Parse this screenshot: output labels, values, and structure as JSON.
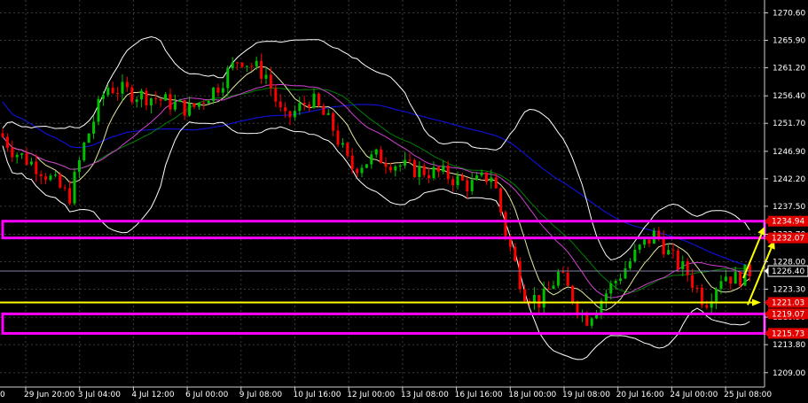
{
  "chart_data": {
    "type": "candlestick",
    "title": "",
    "grid": true,
    "y_axis_side": "right",
    "ylim": [
      1207.3,
      1272.2
    ],
    "y_ticks": [
      "1270.60",
      "1265.90",
      "1261.20",
      "1256.40",
      "1251.70",
      "1246.90",
      "1242.20",
      "1237.50",
      "1232.70",
      "1228.00",
      "1223.30",
      "1218.50",
      "1213.80",
      "1209.00"
    ],
    "x_ticks": [
      "29 Jun 20:00",
      "3 Jul 04:00",
      "4 Jul 12:00",
      "6 Jul 00:00",
      "9 Jul 08:00",
      "10 Jul 16:00",
      "12 Jul 00:00",
      "13 Jul 08:00",
      "16 Jul 16:00",
      "18 Jul 00:00",
      "19 Jul 08:00",
      "20 Jul 16:00",
      "24 Jul 00:00",
      "25 Jul 08:00"
    ],
    "x_tick_first_fragment": "0",
    "price_badges": [
      {
        "label": "1234.94",
        "value": 1234.94,
        "color": "#e00000"
      },
      {
        "label": "1232.07",
        "value": 1232.07,
        "color": "#e00000"
      },
      {
        "label": "1226.40",
        "value": 1226.4,
        "color": "#ffffff"
      },
      {
        "label": "1221.03",
        "value": 1221.03,
        "color": "#e00000"
      },
      {
        "label": "1219.07",
        "value": 1219.07,
        "color": "#e00000"
      },
      {
        "label": "1215.73",
        "value": 1215.73,
        "color": "#e00000"
      }
    ],
    "current_price": 1226.4,
    "horizontal_lines": [
      {
        "name": "support-line",
        "value": 1221.03,
        "color": "#ffff00"
      }
    ],
    "zones": [
      {
        "name": "resistance-zone",
        "top": 1234.94,
        "bottom": 1232.07,
        "color": "#ff00ff"
      },
      {
        "name": "support-zone",
        "top": 1219.07,
        "bottom": 1215.73,
        "color": "#ff00ff"
      }
    ],
    "arrows": [
      {
        "name": "arrow-upper",
        "color": "#ffff00"
      },
      {
        "name": "arrow-lower",
        "color": "#ffff00"
      }
    ],
    "colors": {
      "bull": "#00c000",
      "bear": "#ff0000",
      "grid": "#3a3a3a",
      "text": "#ffffff",
      "ma_slow": "#1010d0",
      "ma_mid": "#008000",
      "band": "#ffffff"
    },
    "key_points": [
      [
        0,
        1250
      ],
      [
        15,
        1247
      ],
      [
        45,
        1244
      ],
      [
        78,
        1239
      ],
      [
        95,
        1248
      ],
      [
        120,
        1258
      ],
      [
        145,
        1257
      ],
      [
        175,
        1256
      ],
      [
        215,
        1254
      ],
      [
        245,
        1258
      ],
      [
        270,
        1263
      ],
      [
        300,
        1260
      ],
      [
        320,
        1252
      ],
      [
        350,
        1256
      ],
      [
        375,
        1251
      ],
      [
        395,
        1244
      ],
      [
        425,
        1246
      ],
      [
        460,
        1244
      ],
      [
        500,
        1243
      ],
      [
        530,
        1241
      ],
      [
        555,
        1243
      ],
      [
        570,
        1233
      ],
      [
        590,
        1223
      ],
      [
        610,
        1221
      ],
      [
        630,
        1226
      ],
      [
        660,
        1218
      ],
      [
        680,
        1222
      ],
      [
        700,
        1226
      ],
      [
        720,
        1230
      ],
      [
        740,
        1233
      ],
      [
        755,
        1229
      ],
      [
        775,
        1226
      ],
      [
        795,
        1221
      ],
      [
        815,
        1226
      ],
      [
        830,
        1225
      ],
      [
        845,
        1226.4
      ]
    ]
  }
}
